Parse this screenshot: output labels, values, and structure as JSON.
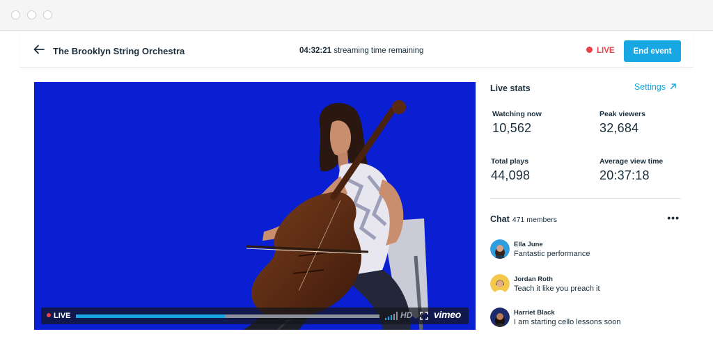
{
  "window": {
    "controls": [
      "close",
      "minimize",
      "zoom"
    ]
  },
  "header": {
    "title": "The Brooklyn String Orchestra",
    "time_remaining": "04:32:21",
    "time_suffix": "streaming time remaining",
    "live_label": "LIVE",
    "end_button": "End event"
  },
  "player": {
    "live_label": "LIVE",
    "progress_fraction": 0.49,
    "quality_label": "HD",
    "brand": "vimeo",
    "icons": [
      "signal-icon",
      "fullscreen-icon"
    ]
  },
  "stats": {
    "title": "Live stats",
    "settings_label": "Settings",
    "items": [
      {
        "label": "Watching now",
        "value": "10,562"
      },
      {
        "label": "Peak viewers",
        "value": "32,684"
      },
      {
        "label": "Total plays",
        "value": "44,098"
      },
      {
        "label": "Average view time",
        "value": "20:37:18"
      }
    ]
  },
  "chat": {
    "title": "Chat",
    "members": "471 members",
    "menu_icon": "more-icon",
    "messages": [
      {
        "name": "Ella June",
        "text": "Fantastic performance",
        "avatar_color": "#2f9de0"
      },
      {
        "name": "Jordan Roth",
        "text": "Teach it like you preach it",
        "avatar_color": "#f2c94c"
      },
      {
        "name": "Harriet Black",
        "text": "I am starting cello lessons soon",
        "avatar_color": "#1d2a6b"
      }
    ]
  },
  "colors": {
    "accent": "#17a8e3",
    "live": "#e8424b",
    "video_bg": "#0a1fd1",
    "text": "#1a2e3b"
  }
}
